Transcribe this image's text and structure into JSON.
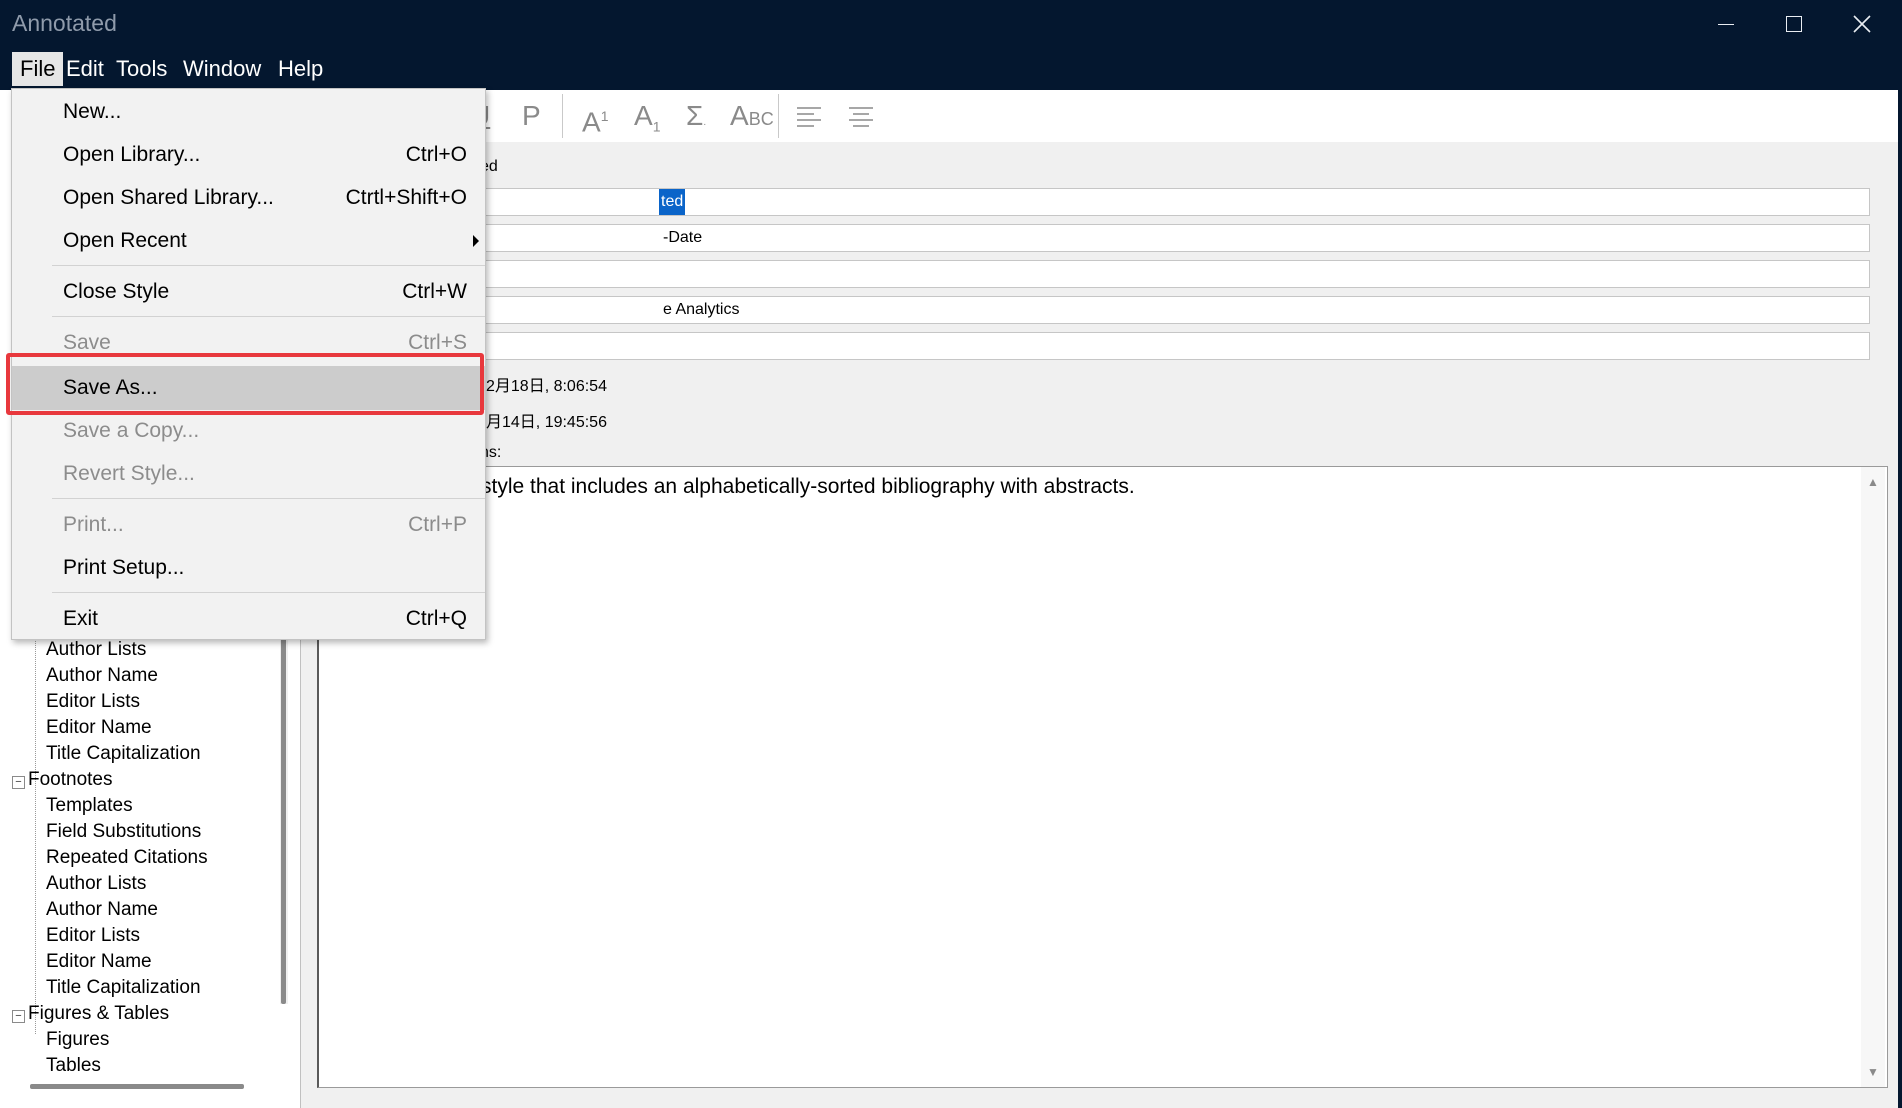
{
  "window": {
    "title": "Annotated",
    "controls": {
      "minimize_icon": "minimize-icon",
      "maximize_icon": "maximize-icon",
      "close_icon": "close-icon"
    }
  },
  "menubar": {
    "items": [
      "File",
      "Edit",
      "Tools",
      "Window",
      "Help"
    ],
    "active": "File"
  },
  "toolbar": {
    "buttons": [
      "underline",
      "plain",
      "superscript",
      "subscript",
      "symbol",
      "small-caps",
      "align-left",
      "align-center"
    ],
    "labels": {
      "underline": "U",
      "plain": "P",
      "superscript_base": "A",
      "superscript_exp": "1",
      "subscript_base": "A",
      "subscript_exp": "1",
      "symbol": "Σ",
      "small_caps_big": "A",
      "small_caps_small": "BC"
    }
  },
  "file_menu": {
    "items": [
      {
        "label": "New...",
        "shortcut": "",
        "enabled": true
      },
      {
        "label": "Open Library...",
        "shortcut": "Ctrl+O",
        "enabled": true
      },
      {
        "label": "Open Shared Library...",
        "shortcut": "Ctrtl+Shift+O",
        "enabled": true
      },
      {
        "label": "Open Recent",
        "shortcut": "",
        "enabled": true,
        "submenu": true
      },
      {
        "label": "Close Style",
        "shortcut": "Ctrl+W",
        "enabled": true
      },
      {
        "label": "Save",
        "shortcut": "Ctrl+S",
        "enabled": false
      },
      {
        "label": "Save As...",
        "shortcut": "",
        "enabled": true,
        "highlighted": true
      },
      {
        "label": "Save a Copy...",
        "shortcut": "",
        "enabled": false
      },
      {
        "label": "Revert Style...",
        "shortcut": "",
        "enabled": false
      },
      {
        "label": "Print...",
        "shortcut": "Ctrl+P",
        "enabled": false
      },
      {
        "label": "Print Setup...",
        "shortcut": "",
        "enabled": true
      },
      {
        "label": "Exit",
        "shortcut": "Ctrl+Q",
        "enabled": true
      }
    ]
  },
  "sidebar": {
    "group1_children": [
      "Author Lists",
      "Author Name",
      "Editor Lists",
      "Editor Name",
      "Title Capitalization"
    ],
    "footnotes": {
      "label": "Footnotes",
      "toggle": "⊟",
      "children": [
        "Templates",
        "Field Substitutions",
        "Repeated Citations",
        "Author Lists",
        "Author Name",
        "Editor Lists",
        "Editor Name",
        "Title Capitalization"
      ]
    },
    "figures_tables": {
      "label": "Figures & Tables",
      "toggle": "⊟",
      "children": [
        "Figures",
        "Tables"
      ]
    }
  },
  "about": {
    "visible_label_fragment": "ed",
    "fields": [
      "ted",
      "-Date",
      "",
      "e Analytics",
      ""
    ],
    "created_fragment": "2月18日, 8:06:54",
    "modified_fragment": "月14日, 19:45:56",
    "comments_label_fragment": "ns:",
    "comments_text": "style that includes an alphabetically-sorted bibliography with abstracts."
  }
}
